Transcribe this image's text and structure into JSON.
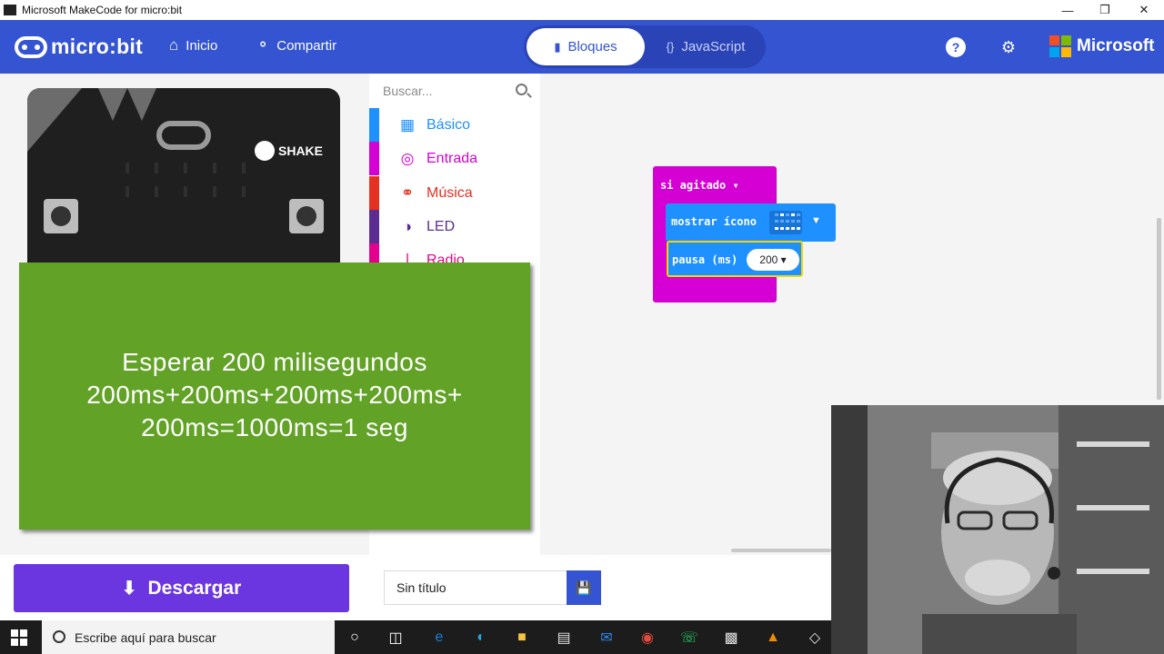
{
  "window": {
    "title": "Microsoft MakeCode for micro:bit",
    "minimize_icon": "minimize-icon",
    "restore_icon": "restore-icon",
    "close_icon": "close-icon"
  },
  "header": {
    "brand": "micro:bit",
    "home_label": "Inicio",
    "share_label": "Compartir",
    "tabs": {
      "blocks_label": "Bloques",
      "js_label": "JavaScript"
    },
    "microsoft_label": "Microsoft",
    "colors": {
      "header_bg": "#3454d1"
    }
  },
  "simulator": {
    "shake_label": "SHAKE"
  },
  "toolbox": {
    "search_placeholder": "Buscar...",
    "categories": [
      {
        "label": "Básico",
        "color": "#1e90ff",
        "icon": "grid-icon"
      },
      {
        "label": "Entrada",
        "color": "#d400d4",
        "icon": "target-icon"
      },
      {
        "label": "Música",
        "color": "#e63022",
        "icon": "headphones-icon"
      },
      {
        "label": "LED",
        "color": "#5c2d91",
        "icon": "toggle-icon"
      },
      {
        "label": "Radio",
        "color": "#e3008c",
        "icon": "radio-icon"
      }
    ]
  },
  "workspace": {
    "event_block": "si  agitado",
    "show_icon_block": "mostrar ícono",
    "pause_block": "pausa (ms)",
    "pause_value": "200"
  },
  "overlay": {
    "line1": "Esperar 200 milisegundos",
    "line2": "200ms+200ms+200ms+200ms+",
    "line3": "200ms=1000ms=1 seg",
    "bg_color": "#62a227"
  },
  "footer": {
    "download_label": "Descargar",
    "project_name": "Sin título"
  },
  "taskbar": {
    "search_placeholder": "Escribe aquí para buscar"
  }
}
